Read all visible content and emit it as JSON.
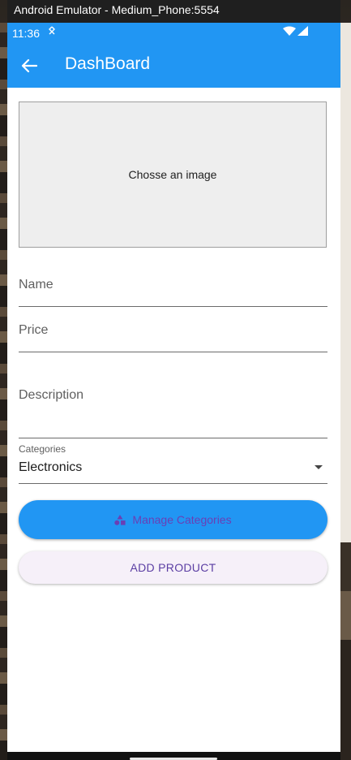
{
  "window": {
    "title": "Android Emulator - Medium_Phone:5554"
  },
  "status_bar": {
    "time": "11:36"
  },
  "app_bar": {
    "title": "DashBoard"
  },
  "image_picker": {
    "label": "Chosse an image"
  },
  "fields": {
    "name": {
      "label": "Name",
      "value": ""
    },
    "price": {
      "label": "Price",
      "value": ""
    },
    "description": {
      "label": "Description",
      "value": ""
    }
  },
  "categories_dropdown": {
    "label": "Categories",
    "selected": "Electronics"
  },
  "buttons": {
    "manage_categories": "Manage Categories",
    "add_product": "ADD PRODUCT"
  },
  "colors": {
    "primary": "#2196f3",
    "button_text_purple": "#6a3fb5",
    "add_button_bg": "#f6f0f9"
  }
}
